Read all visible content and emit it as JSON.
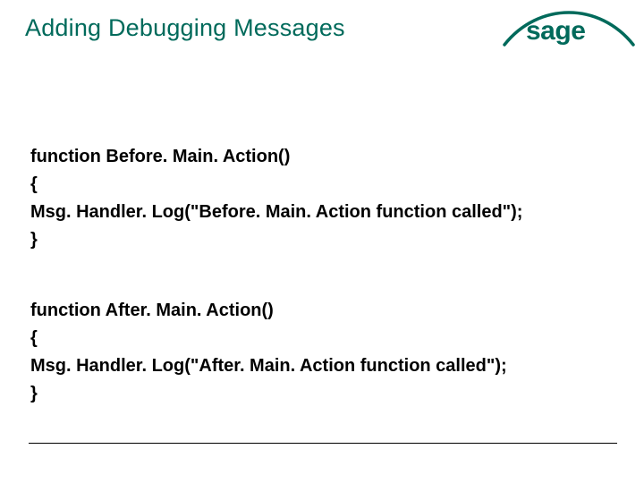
{
  "title": "Adding Debugging Messages",
  "logo": {
    "text": "sage"
  },
  "code_blocks": {
    "before": {
      "l1": "function Before. Main. Action()",
      "l2": "{",
      "l3": "Msg. Handler. Log(\"Before. Main. Action function called\");",
      "l4": "}"
    },
    "after": {
      "l1": "function After. Main. Action()",
      "l2": "{",
      "l3": "Msg. Handler. Log(\"After. Main. Action function called\");",
      "l4": "}"
    }
  }
}
